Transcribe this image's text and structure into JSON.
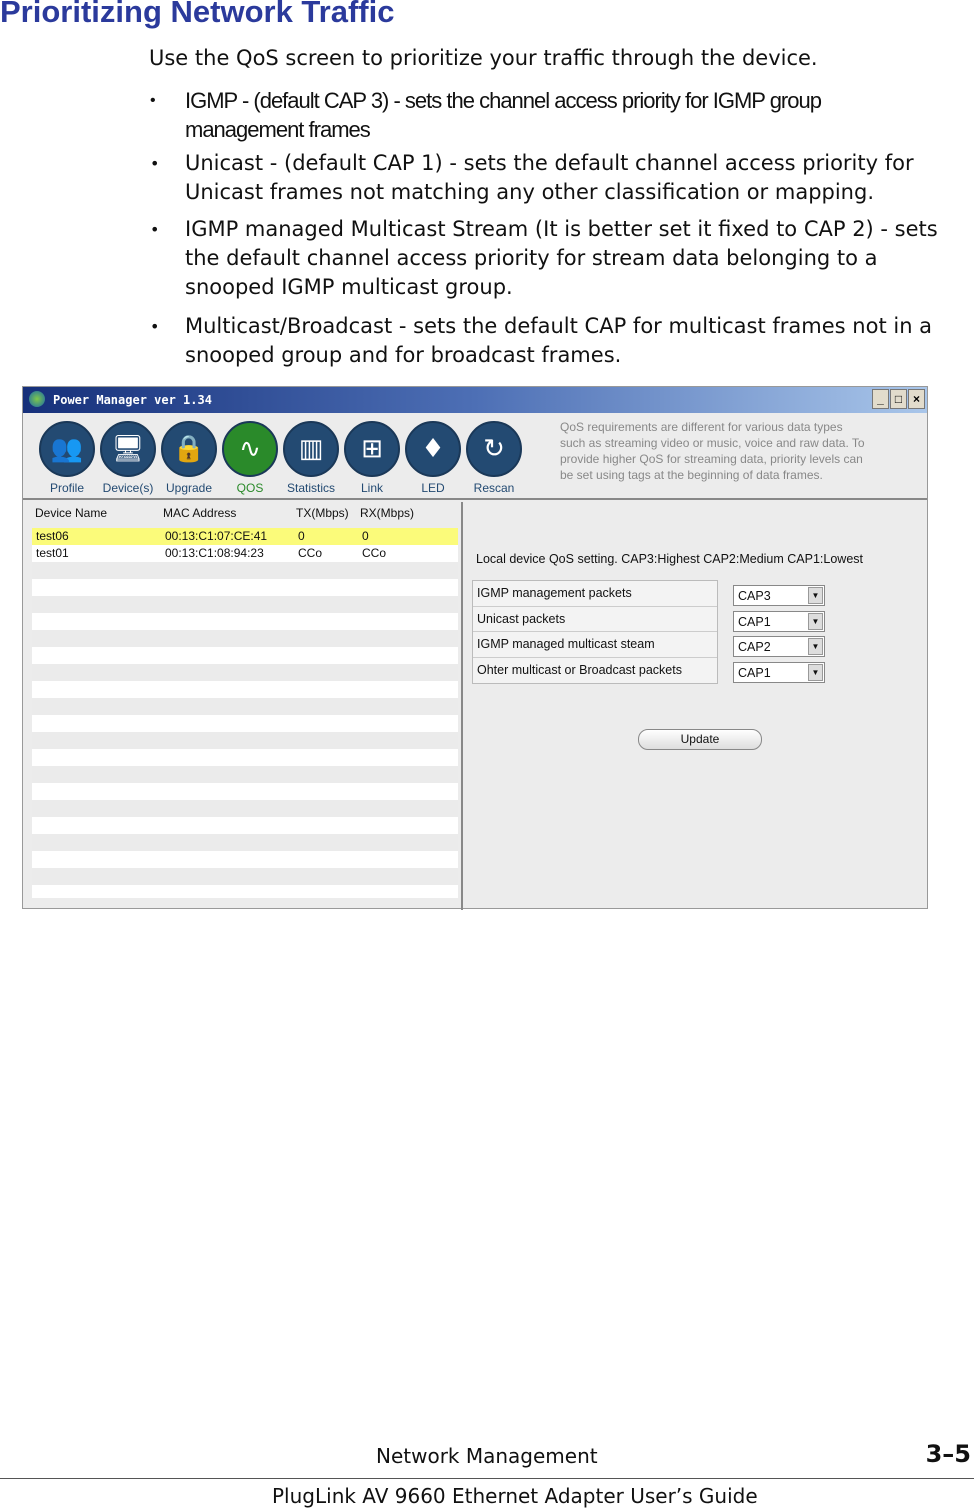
{
  "heading": "Prioritizing Network Traffic",
  "intro": "Use the QoS screen to prioritize your traffic through the device.",
  "bullets": [
    "IGMP - (default CAP 3) - sets the channel access priority for IGMP group management frames",
    "Unicast - (default CAP 1) - sets the default channel access priority for Unicast frames not matching any other classification or mapping.",
    "IGMP managed Multicast Stream (It is better set it fixed to CAP 2) - sets the default channel access priority for stream data belonging to a snooped IGMP multicast group.",
    "Multicast/Broadcast - sets the default CAP for multicast frames not in a snooped group and for broadcast frames."
  ],
  "window": {
    "title": "Power Manager ver 1.34",
    "controls": {
      "minimize": "_",
      "maximize": "□",
      "close": "×"
    },
    "toolbar": [
      {
        "label": "Profile",
        "icon": "people-icon",
        "glyph": "👥"
      },
      {
        "label": "Device(s)",
        "icon": "devices-icon",
        "glyph": "🖥"
      },
      {
        "label": "Upgrade",
        "icon": "lock-upgrade-icon",
        "glyph": "🔒"
      },
      {
        "label": "QOS",
        "icon": "pulse-icon",
        "glyph": "∿"
      },
      {
        "label": "Statistics",
        "icon": "bars-icon",
        "glyph": "▥"
      },
      {
        "label": "Link",
        "icon": "network-icon",
        "glyph": "⊞"
      },
      {
        "label": "LED",
        "icon": "led-icon",
        "glyph": "♦"
      },
      {
        "label": "Rescan",
        "icon": "rescan-icon",
        "glyph": "↻"
      }
    ],
    "active_tool": "QOS",
    "help_text": "QoS requirements are different for various data types such as streaming video or music, voice and raw data. To provide higher QoS for streaming data, priority levels can be set using tags at the beginning of data frames.",
    "device_table": {
      "headers": [
        "Device Name",
        "MAC Address",
        "TX(Mbps)",
        "RX(Mbps)"
      ],
      "rows": [
        [
          "test06",
          "00:13:C1:07:CE:41",
          "0",
          "0"
        ],
        [
          "test01",
          "00:13:C1:08:94:23",
          "CCo",
          "CCo"
        ]
      ]
    },
    "qos": {
      "title": "Local device QoS setting. CAP3:Highest CAP2:Medium CAP1:Lowest",
      "settings": [
        {
          "label": "IGMP management packets",
          "value": "CAP3"
        },
        {
          "label": "Unicast packets",
          "value": "CAP1"
        },
        {
          "label": "IGMP managed multicast steam",
          "value": "CAP2"
        },
        {
          "label": "Ohter multicast or Broadcast packets",
          "value": "CAP1"
        }
      ],
      "update_label": "Update"
    }
  },
  "footer": {
    "section": "Network Management",
    "page": "3–5",
    "guide": "PlugLink AV 9660 Ethernet Adapter User’s Guide"
  },
  "colors": {
    "heading": "#2b3a9c",
    "highlight_row": "#fbfb7a",
    "active_tool": "#2a8a2a"
  }
}
